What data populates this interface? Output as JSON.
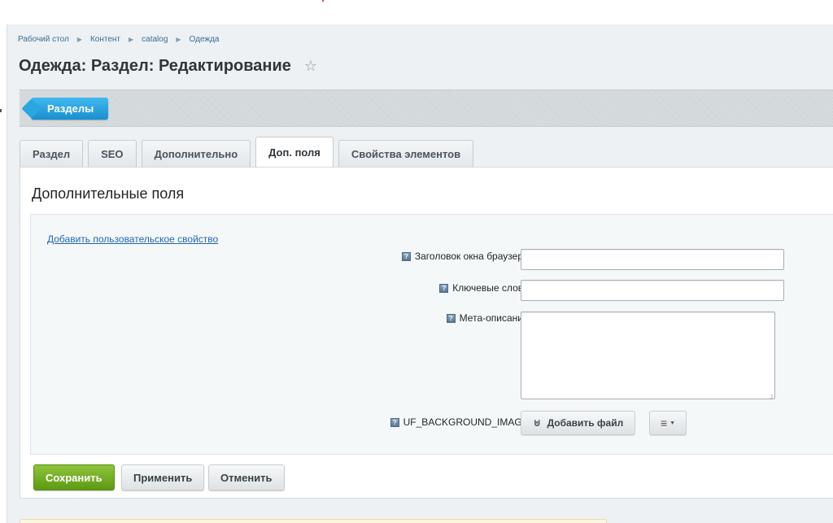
{
  "breadcrumb": {
    "items": [
      "Рабочий стол",
      "Контент",
      "catalog",
      "Одежда"
    ]
  },
  "page": {
    "title": "Одежда: Раздел: Редактирование"
  },
  "toolbar": {
    "sections_label": "Разделы"
  },
  "tabs": [
    {
      "label": "Раздел",
      "active": false
    },
    {
      "label": "SEO",
      "active": false
    },
    {
      "label": "Дополнительно",
      "active": false
    },
    {
      "label": "Доп. поля",
      "active": true
    },
    {
      "label": "Свойства элементов",
      "active": false
    }
  ],
  "panel": {
    "title": "Дополнительные поля",
    "add_property_link": "Добавить пользовательское свойство",
    "fields": {
      "browser_title": {
        "label": "Заголовок окна браузера:",
        "value": ""
      },
      "keywords": {
        "label": "Ключевые слова:",
        "value": ""
      },
      "meta_description": {
        "label": "Мета-описание:",
        "value": ""
      },
      "background_image": {
        "label": "UF_BACKGROUND_IMAGE:",
        "button_label": "Добавить файл"
      }
    }
  },
  "actions": {
    "save_label": "Сохранить",
    "apply_label": "Применить",
    "cancel_label": "Отменить"
  },
  "colors": {
    "accent_blue": "#1a8fd0",
    "save_green": "#5e9a14",
    "link": "#2066b0"
  }
}
